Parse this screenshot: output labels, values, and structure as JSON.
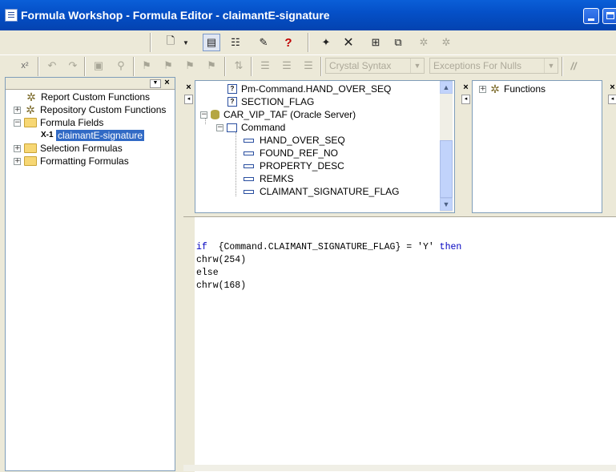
{
  "window": {
    "title": "Formula Workshop - Formula Editor - claimantE-signature"
  },
  "toolbar": {
    "syntax_select": "Crystal Syntax",
    "nulls_select": "Exceptions For Nulls",
    "comment_label": "//"
  },
  "workshop_tree": {
    "items": [
      {
        "label": "Report Custom Functions"
      },
      {
        "label": "Repository Custom Functions"
      },
      {
        "label": "Formula Fields"
      },
      {
        "label": "claimantE-signature"
      },
      {
        "label": "Selection Formulas"
      },
      {
        "label": "Formatting Formulas"
      }
    ]
  },
  "field_tree": {
    "items": [
      {
        "label": "Pm-Command.HAND_OVER_SEQ"
      },
      {
        "label": "SECTION_FLAG"
      },
      {
        "label": "CAR_VIP_TAF (Oracle Server)"
      },
      {
        "label": "Command"
      },
      {
        "label": "HAND_OVER_SEQ"
      },
      {
        "label": "FOUND_REF_NO"
      },
      {
        "label": "PROPERTY_DESC"
      },
      {
        "label": "REMKS"
      },
      {
        "label": "CLAIMANT_SIGNATURE_FLAG"
      }
    ]
  },
  "function_tree": {
    "items": [
      {
        "label": "Functions"
      }
    ]
  },
  "formula": {
    "line1_kw1": "if",
    "line1_mid": "  {Command.CLAIMANT_SIGNATURE_FLAG} = 'Y' ",
    "line1_kw2": "then",
    "line2": "chrw(254)",
    "line3": "else",
    "line4": "chrw(168)"
  }
}
